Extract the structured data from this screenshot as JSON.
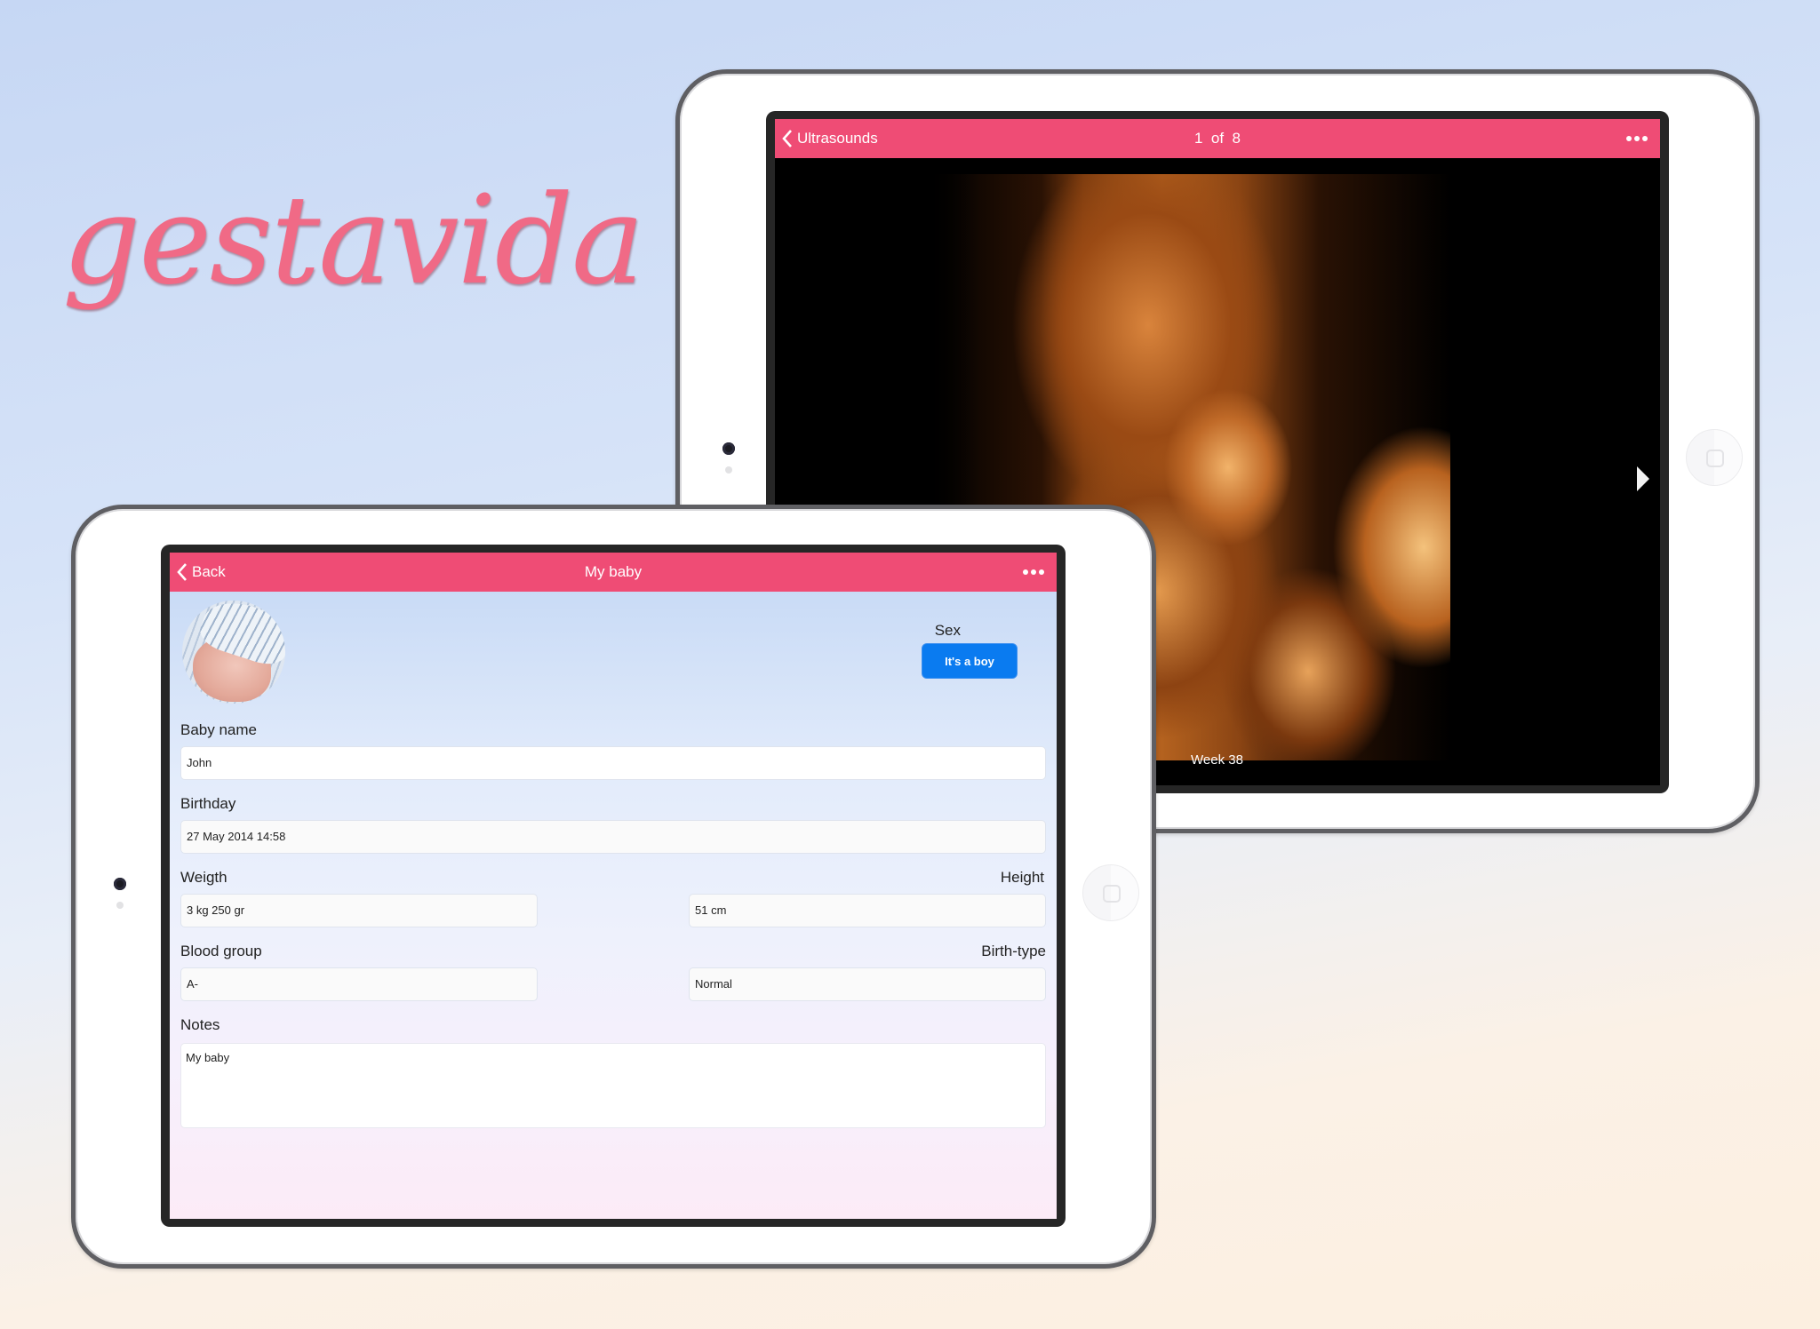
{
  "brand": {
    "logo_text": "gestavida",
    "logo_color": "#f06a86"
  },
  "colors": {
    "navbar": "#ef4c75",
    "primary_button": "#0a7bf0"
  },
  "ultrasound_screen": {
    "navbar": {
      "back_label": "Ultrasounds",
      "title": "1  of  8",
      "more_icon": "ellipsis-icon"
    },
    "image_caption": "Week 38",
    "next_icon": "chevron-right-icon"
  },
  "baby_screen": {
    "navbar": {
      "back_label": "Back",
      "title": "My baby",
      "more_icon": "ellipsis-icon"
    },
    "sex": {
      "label": "Sex",
      "button_label": "It's a boy"
    },
    "fields": {
      "baby_name": {
        "label": "Baby name",
        "value": "John"
      },
      "birthday": {
        "label": "Birthday",
        "value": "27 May 2014 14:58"
      },
      "weight": {
        "label": "Weigth",
        "value": "3 kg 250 gr"
      },
      "height": {
        "label": "Height",
        "value": "51 cm"
      },
      "blood_group": {
        "label": "Blood group",
        "value": "A-"
      },
      "birth_type": {
        "label": "Birth-type",
        "value": "Normal"
      },
      "notes": {
        "label": "Notes",
        "value": "My baby"
      }
    }
  }
}
